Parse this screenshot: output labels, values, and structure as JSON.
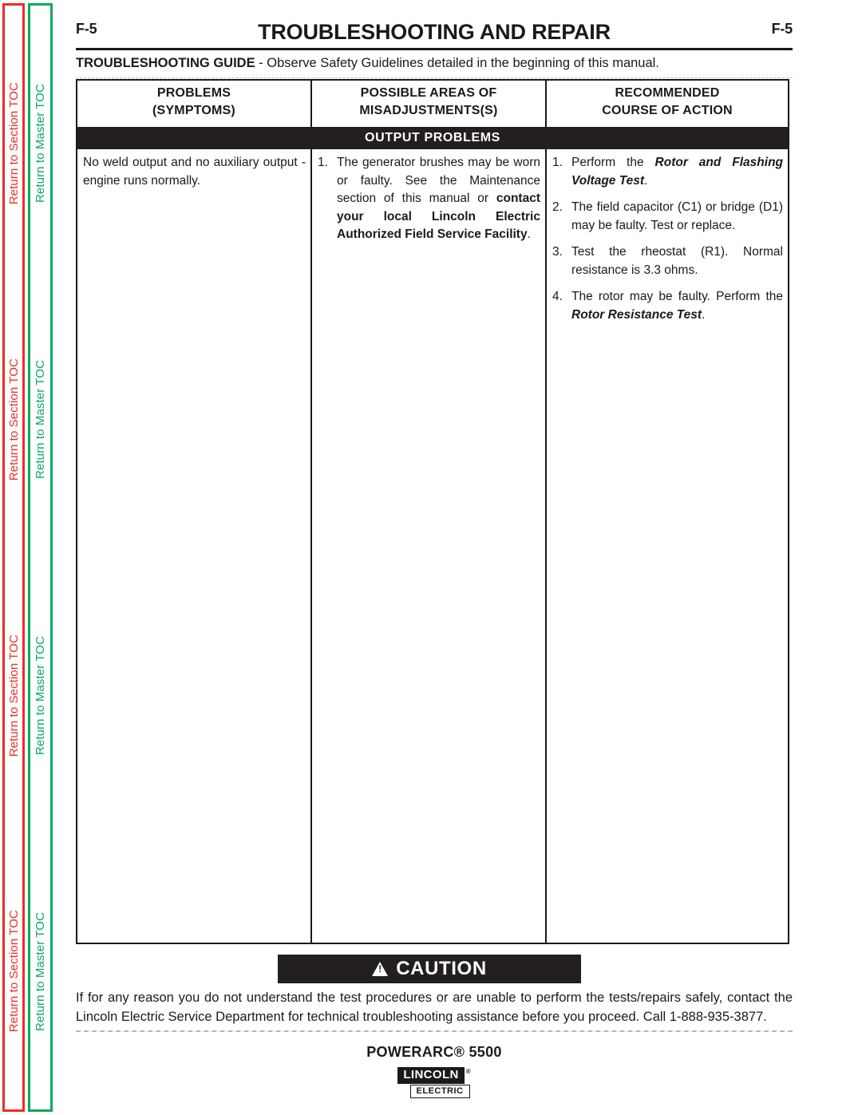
{
  "sidebar": {
    "section_toc": {
      "label": "Return to Section TOC",
      "color": "#ee2d24",
      "repeat": 4
    },
    "master_toc": {
      "label": "Return to Master TOC",
      "color": "#0aa95c",
      "repeat": 4
    }
  },
  "header": {
    "folio_left": "F-5",
    "folio_right": "F-5",
    "title": "TROUBLESHOOTING AND REPAIR",
    "guide_label": "TROUBLESHOOTING GUIDE",
    "guide_text": " - Observe Safety Guidelines detailed in the beginning of this manual."
  },
  "table": {
    "columns": [
      {
        "line1": "PROBLEMS",
        "line2": "(SYMPTOMS)"
      },
      {
        "line1": "POSSIBLE AREAS OF",
        "line2": "MISADJUSTMENTS(S)"
      },
      {
        "line1": "RECOMMENDED",
        "line2": "COURSE OF ACTION"
      }
    ],
    "section_band": "OUTPUT  PROBLEMS",
    "rows": [
      {
        "symptom": "No weld output and no auxiliary output - engine runs normally.",
        "possible_areas": [
          {
            "num": "1.",
            "normal_a": "The generator brushes may be worn or faulty.  See the Maintenance section of this manual or ",
            "bold": "contact your local Lincoln Electric Authorized Field Service Facility",
            "normal_b": "."
          }
        ],
        "course_of_action": [
          {
            "num": "1.",
            "normal_a": "Perform the ",
            "emph": "Rotor and Flashing Voltage Test",
            "normal_b": "."
          },
          {
            "num": "2.",
            "normal_a": "The field capacitor (C1) or bridge (D1) may be faulty.  Test or replace.",
            "emph": "",
            "normal_b": ""
          },
          {
            "num": "3.",
            "normal_a": "Test the rheostat (R1).  Normal resistance is 3.3 ohms.",
            "emph": "",
            "normal_b": ""
          },
          {
            "num": "4.",
            "normal_a": "The rotor may be faulty.  Perform the ",
            "emph": "Rotor Resistance Test",
            "normal_b": "."
          }
        ]
      }
    ]
  },
  "caution": {
    "label": "CAUTION",
    "icon": "warning-triangle-icon",
    "body": "If for any reason you do not understand the test procedures or are unable to perform the tests/repairs safely, contact the Lincoln Electric Service Department for technical troubleshooting assistance before you proceed. Call 1-888-935-3877."
  },
  "footer": {
    "model": "POWERARC® 5500",
    "logo_top": "LINCOLN",
    "logo_reg": "®",
    "logo_bottom": "ELECTRIC"
  }
}
